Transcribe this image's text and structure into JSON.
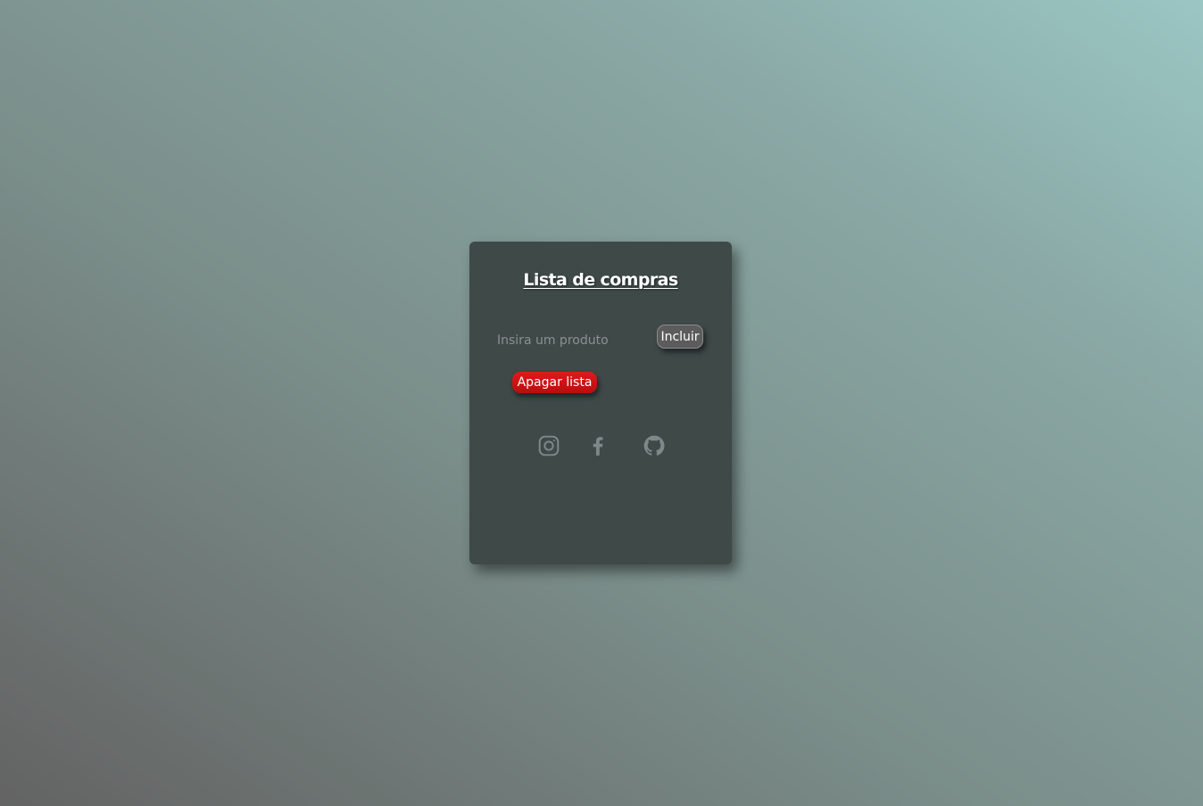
{
  "card": {
    "title": "Lista de compras",
    "input": {
      "placeholder": "Insira um produto",
      "value": ""
    },
    "include_label": "Incluir",
    "clear_label": "Apagar lista"
  },
  "social": [
    {
      "icon": "instagram-icon"
    },
    {
      "icon": "facebook-icon"
    },
    {
      "icon": "github-icon"
    }
  ],
  "colors": {
    "card_bg": "#3e4948",
    "clear_button": "#d41414",
    "include_button": "#5c5c5c",
    "icon": "#7f8888"
  }
}
